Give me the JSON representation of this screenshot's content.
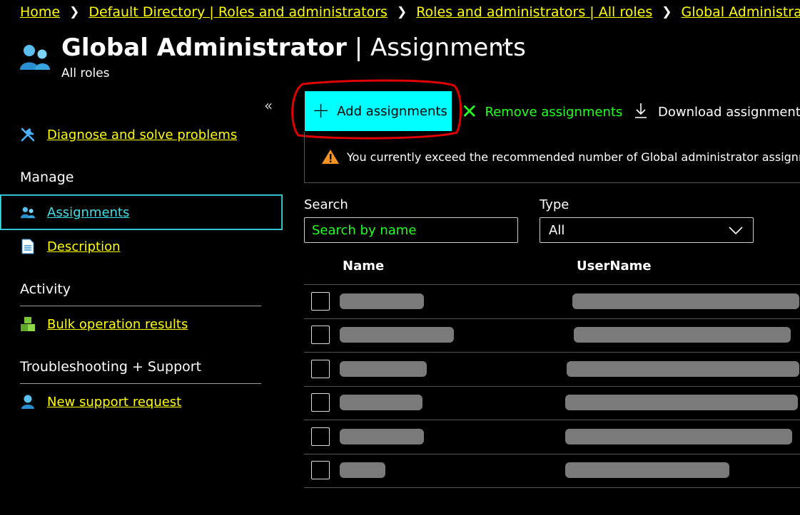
{
  "breadcrumb": [
    "Home",
    "Default Directory | Roles and administrators",
    "Roles and administrators | All roles",
    "Global Administrator"
  ],
  "header": {
    "title_bold": "Global Administrator",
    "title_rest": "| Assignments",
    "subtitle": "All roles",
    "more": "···",
    "collapse": "«"
  },
  "sidebar": {
    "diagnose": "Diagnose and solve problems",
    "manage_heading": "Manage",
    "assignments": "Assignments",
    "description": "Description",
    "activity_heading": "Activity",
    "bulk": "Bulk operation results",
    "troubleshoot_heading": "Troubleshooting + Support",
    "support": "New support request"
  },
  "toolbar": {
    "add": "Add assignments",
    "remove": "Remove assignments",
    "download": "Download assignments"
  },
  "warning": {
    "text": "You currently exceed the recommended number of Global administrator assignm"
  },
  "filters": {
    "search_label": "Search",
    "search_placeholder": "Search by name",
    "type_label": "Type",
    "type_value": "All"
  },
  "table": {
    "col_name": "Name",
    "col_username": "UserName",
    "row_count": 6
  },
  "colors": {
    "link": "#ffff00",
    "accent": "#00ffff",
    "remove": "#22ff22",
    "annotation": "#e00000"
  }
}
